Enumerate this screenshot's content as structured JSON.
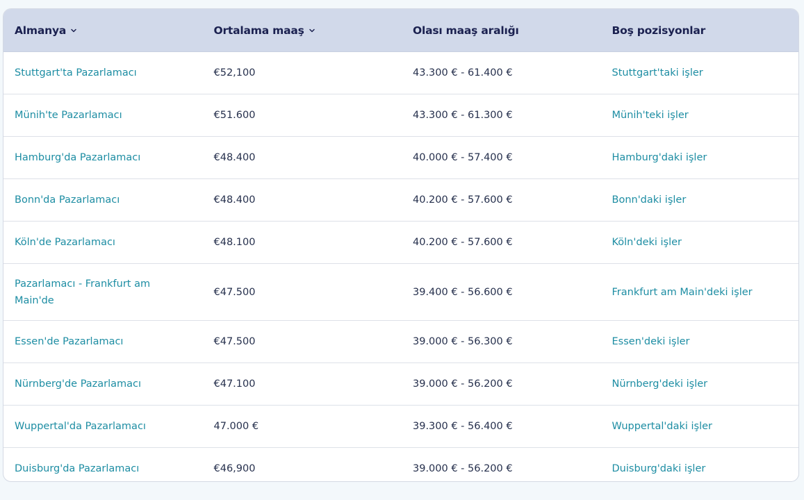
{
  "table": {
    "headers": {
      "city": "Almanya",
      "avg_salary": "Ortalama maaş",
      "range": "Olası maaş aralığı",
      "jobs": "Boş pozisyonlar"
    },
    "rows": [
      {
        "title": "Stuttgart'ta Pazarlamacı",
        "avg": "€52,100",
        "range": "43.300 € - 61.400 €",
        "jobs": "Stuttgart'taki işler"
      },
      {
        "title": "Münih'te Pazarlamacı",
        "avg": "€51.600",
        "range": "43.300 € - 61.300 €",
        "jobs": "Münih'teki işler"
      },
      {
        "title": "Hamburg'da Pazarlamacı",
        "avg": "€48.400",
        "range": "40.000 € - 57.400 €",
        "jobs": "Hamburg'daki işler"
      },
      {
        "title": "Bonn'da Pazarlamacı",
        "avg": "€48.400",
        "range": "40.200 € - 57.600 €",
        "jobs": "Bonn'daki işler"
      },
      {
        "title": "Köln'de Pazarlamacı",
        "avg": "€48.100",
        "range": "40.200 € - 57.600 €",
        "jobs": "Köln'deki işler"
      },
      {
        "title": "Pazarlamacı - Frankfurt am Main'de",
        "avg": "€47.500",
        "range": "39.400 € - 56.600 €",
        "jobs": "Frankfurt am Main'deki işler"
      },
      {
        "title": "Essen'de Pazarlamacı",
        "avg": "€47.500",
        "range": "39.000 € - 56.300 €",
        "jobs": "Essen'deki işler"
      },
      {
        "title": "Nürnberg'de Pazarlamacı",
        "avg": "€47.100",
        "range": "39.000 € - 56.200 €",
        "jobs": "Nürnberg'deki işler"
      },
      {
        "title": "Wuppertal'da Pazarlamacı",
        "avg": "47.000 €",
        "range": "39.300 € - 56.400 €",
        "jobs": "Wuppertal'daki işler"
      },
      {
        "title": "Duisburg'da Pazarlamacı",
        "avg": "€46,900",
        "range": "39.000 € - 56.200 €",
        "jobs": "Duisburg'daki işler"
      }
    ]
  },
  "colors": {
    "header_bg": "#d1d9ea",
    "header_text": "#1b2150",
    "link": "#1d8da3",
    "text": "#26304d"
  },
  "icons": {
    "sort_city": "chevron-down-icon",
    "sort_avg": "chevron-down-icon"
  }
}
